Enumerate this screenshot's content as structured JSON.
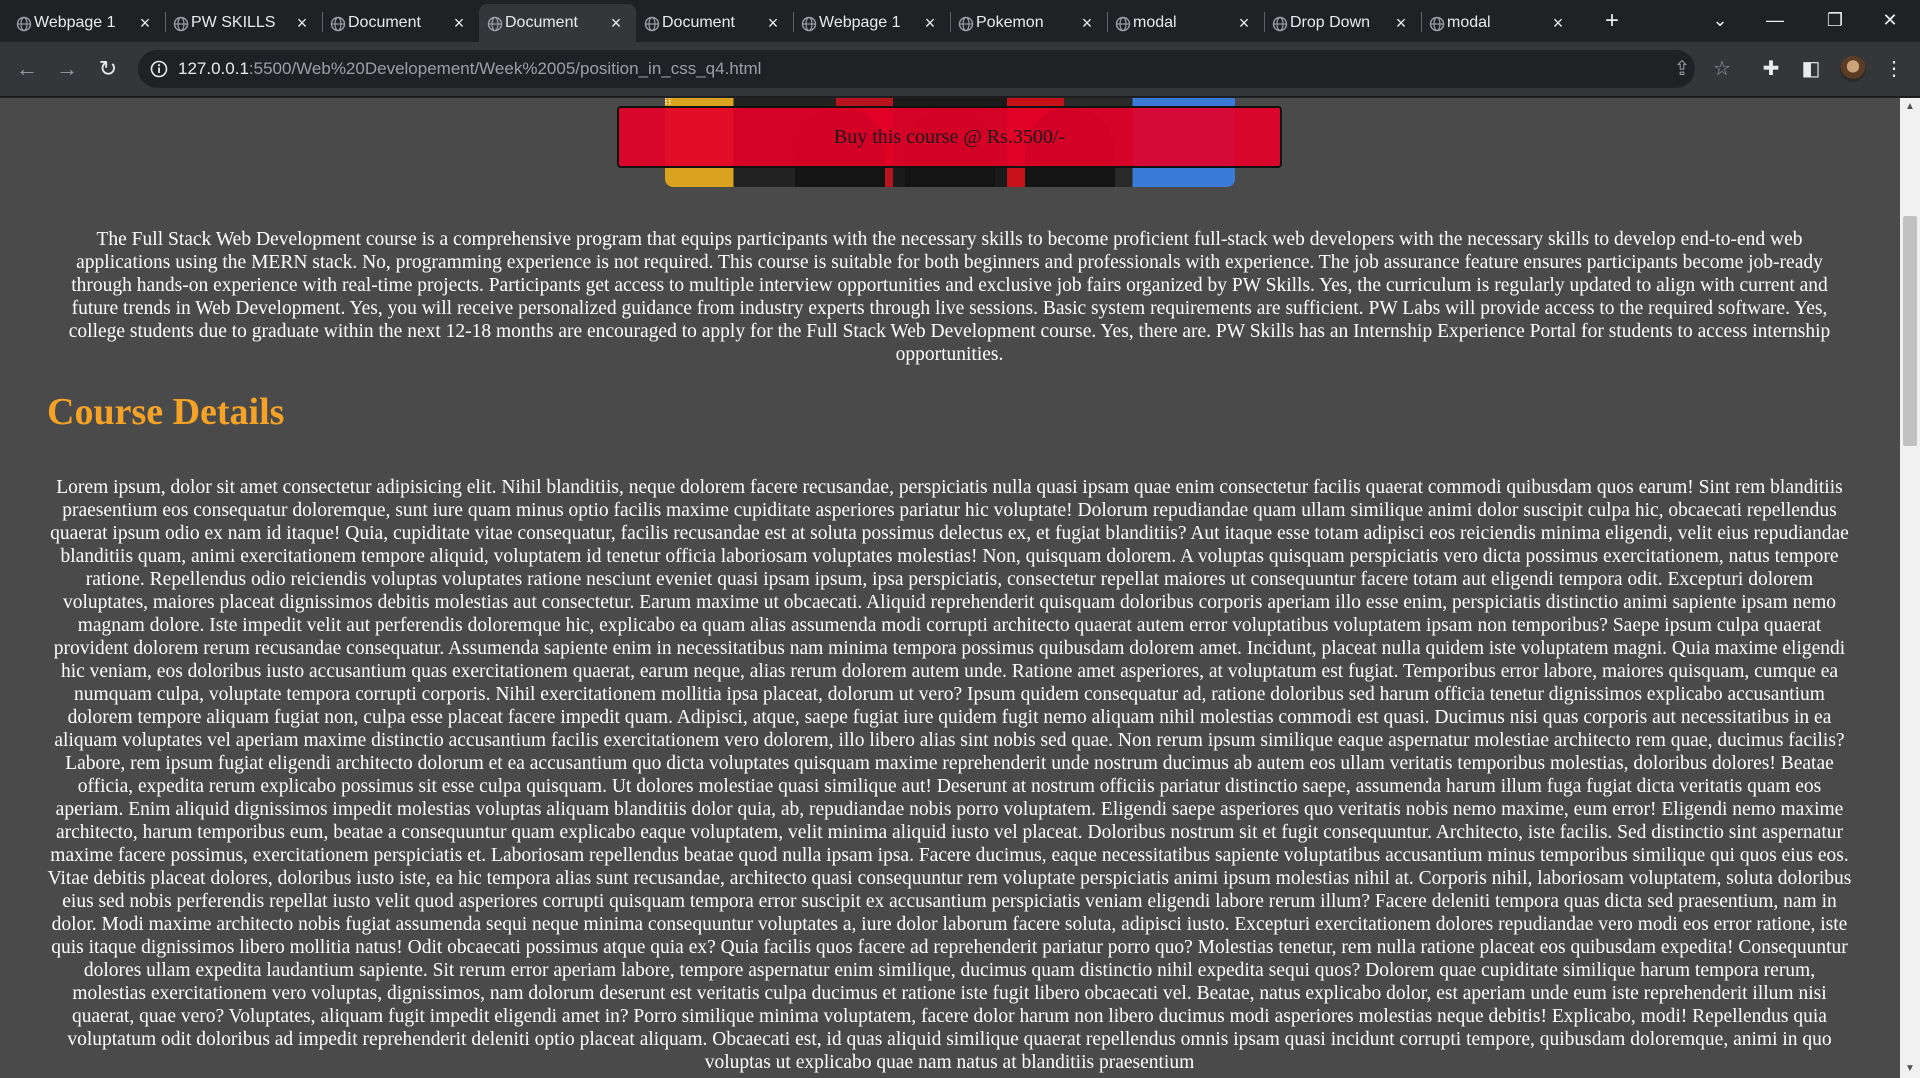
{
  "tabs": [
    {
      "title": "Webpage 1",
      "close": "×"
    },
    {
      "title": "PW SKILLS",
      "close": "×"
    },
    {
      "title": "Document",
      "close": "×"
    },
    {
      "title": "Document",
      "close": "×"
    },
    {
      "title": "Document",
      "close": "×"
    },
    {
      "title": "Webpage 1",
      "close": "×"
    },
    {
      "title": "Pokemon",
      "close": "×"
    },
    {
      "title": "modal",
      "close": "×"
    },
    {
      "title": "Drop Down",
      "close": "×"
    },
    {
      "title": "modal",
      "close": "×"
    }
  ],
  "active_tab_index": 3,
  "toolbar": {
    "url_host": "127.0.0.1",
    "url_rest": ":5500/Web%20Developement/Week%2005/position_in_css_q4.html"
  },
  "page": {
    "buy_button": "Buy this course @ Rs.3500/-",
    "intro": "The Full Stack Web Development course is a comprehensive program that equips participants with the necessary skills to become proficient full-stack web developers with the necessary skills to develop end-to-end web applications using the MERN stack. No, programming experience is not required. This course is suitable for both beginners and professionals with experience. The job assurance feature ensures participants become job-ready through hands-on experience with real-time projects. Participants get access to multiple interview opportunities and exclusive job fairs organized by PW Skills. Yes, the curriculum is regularly updated to align with current and future trends in Web Development. Yes, you will receive personalized guidance from industry experts through live sessions. Basic system requirements are sufficient. PW Labs will provide access to the required software. Yes, college students due to graduate within the next 12-18 months are encouraged to apply for the Full Stack Web Development course. Yes, there are. PW Skills has an Internship Experience Portal for students to access internship opportunities.",
    "heading": "Course Details",
    "details": "Lorem ipsum, dolor sit amet consectetur adipisicing elit. Nihil blanditiis, neque dolorem facere recusandae, perspiciatis nulla quasi ipsam quae enim consectetur facilis quaerat commodi quibusdam quos earum! Sint rem blanditiis praesentium eos consequatur doloremque, sunt iure quam minus optio facilis maxime cupiditate asperiores pariatur hic voluptate! Dolorum repudiandae quam ullam similique animi dolor suscipit culpa hic, obcaecati repellendus quaerat ipsum odio ex nam id itaque! Quia, cupiditate vitae consequatur, facilis recusandae est at soluta possimus delectus ex, et fugiat blanditiis? Aut itaque esse totam adipisci eos reiciendis minima eligendi, velit eius repudiandae blanditiis quam, animi exercitationem tempore aliquid, voluptatem id tenetur officia laboriosam voluptates molestias! Non, quisquam dolorem. A voluptas quisquam perspiciatis vero dicta possimus exercitationem, natus tempore ratione. Repellendus odio reiciendis voluptas voluptates ratione nesciunt eveniet quasi ipsam ipsum, ipsa perspiciatis, consectetur repellat maiores ut consequuntur facere totam aut eligendi tempora odit. Excepturi dolorem voluptates, maiores placeat dignissimos debitis molestias aut consectetur. Earum maxime ut obcaecati. Aliquid reprehenderit quisquam doloribus corporis aperiam illo esse enim, perspiciatis distinctio animi sapiente ipsam nemo magnam dolore. Iste impedit velit aut perferendis doloremque hic, explicabo ea quam alias assumenda modi corrupti architecto quaerat autem error voluptatibus voluptatem ipsam non temporibus? Saepe ipsum culpa quaerat provident dolorem rerum recusandae consequatur. Assumenda sapiente enim in necessitatibus nam minima tempora possimus quibusdam dolorem amet. Incidunt, placeat nulla quidem iste voluptatem magni. Quia maxime eligendi hic veniam, eos doloribus iusto accusantium quas exercitationem quaerat, earum neque, alias rerum dolorem autem unde. Ratione amet asperiores, at voluptatum est fugiat. Temporibus error labore, maiores quisquam, cumque ea numquam culpa, voluptate tempora corrupti corporis. Nihil exercitationem mollitia ipsa placeat, dolorum ut vero? Ipsum quidem consequatur ad, ratione doloribus sed harum officia tenetur dignissimos explicabo accusantium dolorem tempore aliquam fugiat non, culpa esse placeat facere impedit quam. Adipisci, atque, saepe fugiat iure quidem fugit nemo aliquam nihil molestias commodi est quasi. Ducimus nisi quas corporis aut necessitatibus in ea aliquam voluptates vel aperiam maxime distinctio accusantium facilis exercitationem vero dolorem, illo libero alias sint nobis sed quae. Non rerum ipsum similique eaque aspernatur molestiae architecto rem quae, ducimus facilis? Labore, rem ipsum fugiat eligendi architecto dolorum et ea accusantium quo dicta voluptates quisquam maxime reprehenderit unde nostrum ducimus ab autem eos ullam veritatis temporibus molestias, doloribus dolores! Beatae officia, expedita rerum explicabo possimus sit esse culpa quisquam. Ut dolores molestiae quasi similique aut! Deserunt at nostrum officiis pariatur distinctio saepe, assumenda harum illum fuga fugiat dicta veritatis quam eos aperiam. Enim aliquid dignissimos impedit molestias voluptas aliquam blanditiis dolor quia, ab, repudiandae nobis porro voluptatem. Eligendi saepe asperiores quo veritatis nobis nemo maxime, eum error! Eligendi nemo maxime architecto, harum temporibus eum, beatae a consequuntur quam explicabo eaque voluptatem, velit minima aliquid iusto vel placeat. Doloribus nostrum sit et fugit consequuntur. Architecto, iste facilis. Sed distinctio sint aspernatur maxime facere possimus, exercitationem perspiciatis et. Laboriosam repellendus beatae quod nulla ipsam ipsa. Facere ducimus, eaque necessitatibus sapiente voluptatibus accusantium minus temporibus similique qui quos eius eos. Vitae debitis placeat dolores, doloribus iusto iste, ea hic tempora alias sunt recusandae, architecto quasi consequuntur rem voluptate perspiciatis animi ipsum molestias nihil at. Corporis nihil, laboriosam voluptatem, soluta doloribus eius sed nobis perferendis repellat iusto velit quod asperiores corrupti quisquam tempora error suscipit ex accusantium perspiciatis veniam eligendi labore rerum illum? Facere deleniti tempora quas dicta sed praesentium, nam in dolor. Modi maxime architecto nobis fugiat assumenda sequi neque minima consequuntur voluptates a, iure dolor laborum facere soluta, adipisci iusto. Excepturi exercitationem dolores repudiandae vero modi eos error ratione, iste quis itaque dignissimos libero mollitia natus! Odit obcaecati possimus atque quia ex? Quia facilis quos facere ad reprehenderit pariatur porro quo? Molestias tenetur, rem nulla ratione placeat eos quibusdam expedita! Consequuntur dolores ullam expedita laudantium sapiente. Sit rerum error aperiam labore, tempore aspernatur enim similique, ducimus quam distinctio nihil expedita sequi quos? Dolorem quae cupiditate similique harum tempora rerum, molestias exercitationem vero voluptas, dignissimos, nam dolorum deserunt est veritatis culpa ducimus et ratione iste fugit libero obcaecati vel. Beatae, natus explicabo dolor, est aperiam unde eum iste reprehenderit illum nisi quaerat, quae vero? Voluptates, aliquam fugit impedit eligendi amet in? Porro similique minima voluptatem, facere dolor harum non libero ducimus modi asperiores molestias neque debitis! Explicabo, modi! Repellendus quia voluptatum odit doloribus ad impedit reprehenderit deleniti optio placeat aliquam. Obcaecati est, id quas aliquid similique quaerat repellendus omnis ipsam quasi incidunt corrupti tempore, quibusdam doloremque, animi in quo voluptas ut explicabo quae nam natus at blanditiis praesentium"
  }
}
